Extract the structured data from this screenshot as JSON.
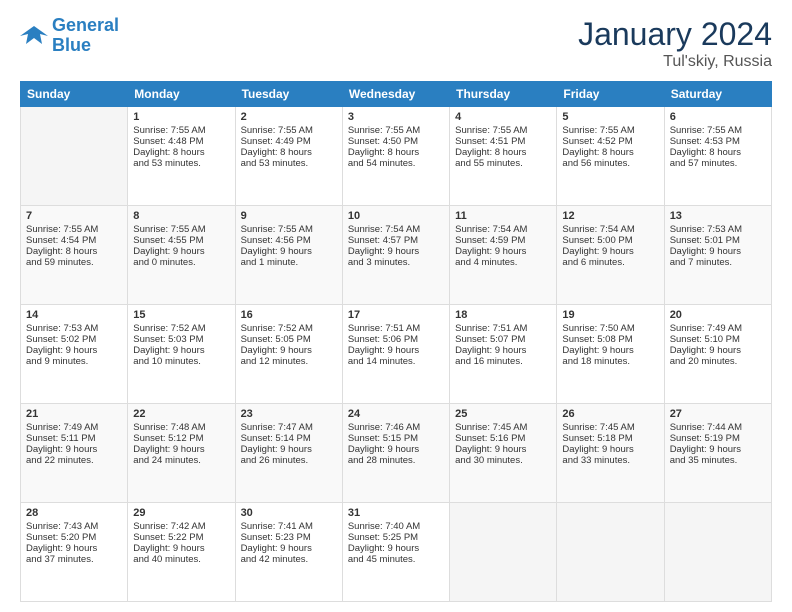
{
  "header": {
    "logo_line1": "General",
    "logo_line2": "Blue",
    "month_title": "January 2024",
    "location": "Tul'skiy, Russia"
  },
  "columns": [
    "Sunday",
    "Monday",
    "Tuesday",
    "Wednesday",
    "Thursday",
    "Friday",
    "Saturday"
  ],
  "weeks": [
    [
      {
        "day": "",
        "info": ""
      },
      {
        "day": "1",
        "info": "Sunrise: 7:55 AM\nSunset: 4:48 PM\nDaylight: 8 hours\nand 53 minutes."
      },
      {
        "day": "2",
        "info": "Sunrise: 7:55 AM\nSunset: 4:49 PM\nDaylight: 8 hours\nand 53 minutes."
      },
      {
        "day": "3",
        "info": "Sunrise: 7:55 AM\nSunset: 4:50 PM\nDaylight: 8 hours\nand 54 minutes."
      },
      {
        "day": "4",
        "info": "Sunrise: 7:55 AM\nSunset: 4:51 PM\nDaylight: 8 hours\nand 55 minutes."
      },
      {
        "day": "5",
        "info": "Sunrise: 7:55 AM\nSunset: 4:52 PM\nDaylight: 8 hours\nand 56 minutes."
      },
      {
        "day": "6",
        "info": "Sunrise: 7:55 AM\nSunset: 4:53 PM\nDaylight: 8 hours\nand 57 minutes."
      }
    ],
    [
      {
        "day": "7",
        "info": "Sunrise: 7:55 AM\nSunset: 4:54 PM\nDaylight: 8 hours\nand 59 minutes."
      },
      {
        "day": "8",
        "info": "Sunrise: 7:55 AM\nSunset: 4:55 PM\nDaylight: 9 hours\nand 0 minutes."
      },
      {
        "day": "9",
        "info": "Sunrise: 7:55 AM\nSunset: 4:56 PM\nDaylight: 9 hours\nand 1 minute."
      },
      {
        "day": "10",
        "info": "Sunrise: 7:54 AM\nSunset: 4:57 PM\nDaylight: 9 hours\nand 3 minutes."
      },
      {
        "day": "11",
        "info": "Sunrise: 7:54 AM\nSunset: 4:59 PM\nDaylight: 9 hours\nand 4 minutes."
      },
      {
        "day": "12",
        "info": "Sunrise: 7:54 AM\nSunset: 5:00 PM\nDaylight: 9 hours\nand 6 minutes."
      },
      {
        "day": "13",
        "info": "Sunrise: 7:53 AM\nSunset: 5:01 PM\nDaylight: 9 hours\nand 7 minutes."
      }
    ],
    [
      {
        "day": "14",
        "info": "Sunrise: 7:53 AM\nSunset: 5:02 PM\nDaylight: 9 hours\nand 9 minutes."
      },
      {
        "day": "15",
        "info": "Sunrise: 7:52 AM\nSunset: 5:03 PM\nDaylight: 9 hours\nand 10 minutes."
      },
      {
        "day": "16",
        "info": "Sunrise: 7:52 AM\nSunset: 5:05 PM\nDaylight: 9 hours\nand 12 minutes."
      },
      {
        "day": "17",
        "info": "Sunrise: 7:51 AM\nSunset: 5:06 PM\nDaylight: 9 hours\nand 14 minutes."
      },
      {
        "day": "18",
        "info": "Sunrise: 7:51 AM\nSunset: 5:07 PM\nDaylight: 9 hours\nand 16 minutes."
      },
      {
        "day": "19",
        "info": "Sunrise: 7:50 AM\nSunset: 5:08 PM\nDaylight: 9 hours\nand 18 minutes."
      },
      {
        "day": "20",
        "info": "Sunrise: 7:49 AM\nSunset: 5:10 PM\nDaylight: 9 hours\nand 20 minutes."
      }
    ],
    [
      {
        "day": "21",
        "info": "Sunrise: 7:49 AM\nSunset: 5:11 PM\nDaylight: 9 hours\nand 22 minutes."
      },
      {
        "day": "22",
        "info": "Sunrise: 7:48 AM\nSunset: 5:12 PM\nDaylight: 9 hours\nand 24 minutes."
      },
      {
        "day": "23",
        "info": "Sunrise: 7:47 AM\nSunset: 5:14 PM\nDaylight: 9 hours\nand 26 minutes."
      },
      {
        "day": "24",
        "info": "Sunrise: 7:46 AM\nSunset: 5:15 PM\nDaylight: 9 hours\nand 28 minutes."
      },
      {
        "day": "25",
        "info": "Sunrise: 7:45 AM\nSunset: 5:16 PM\nDaylight: 9 hours\nand 30 minutes."
      },
      {
        "day": "26",
        "info": "Sunrise: 7:45 AM\nSunset: 5:18 PM\nDaylight: 9 hours\nand 33 minutes."
      },
      {
        "day": "27",
        "info": "Sunrise: 7:44 AM\nSunset: 5:19 PM\nDaylight: 9 hours\nand 35 minutes."
      }
    ],
    [
      {
        "day": "28",
        "info": "Sunrise: 7:43 AM\nSunset: 5:20 PM\nDaylight: 9 hours\nand 37 minutes."
      },
      {
        "day": "29",
        "info": "Sunrise: 7:42 AM\nSunset: 5:22 PM\nDaylight: 9 hours\nand 40 minutes."
      },
      {
        "day": "30",
        "info": "Sunrise: 7:41 AM\nSunset: 5:23 PM\nDaylight: 9 hours\nand 42 minutes."
      },
      {
        "day": "31",
        "info": "Sunrise: 7:40 AM\nSunset: 5:25 PM\nDaylight: 9 hours\nand 45 minutes."
      },
      {
        "day": "",
        "info": ""
      },
      {
        "day": "",
        "info": ""
      },
      {
        "day": "",
        "info": ""
      }
    ]
  ]
}
